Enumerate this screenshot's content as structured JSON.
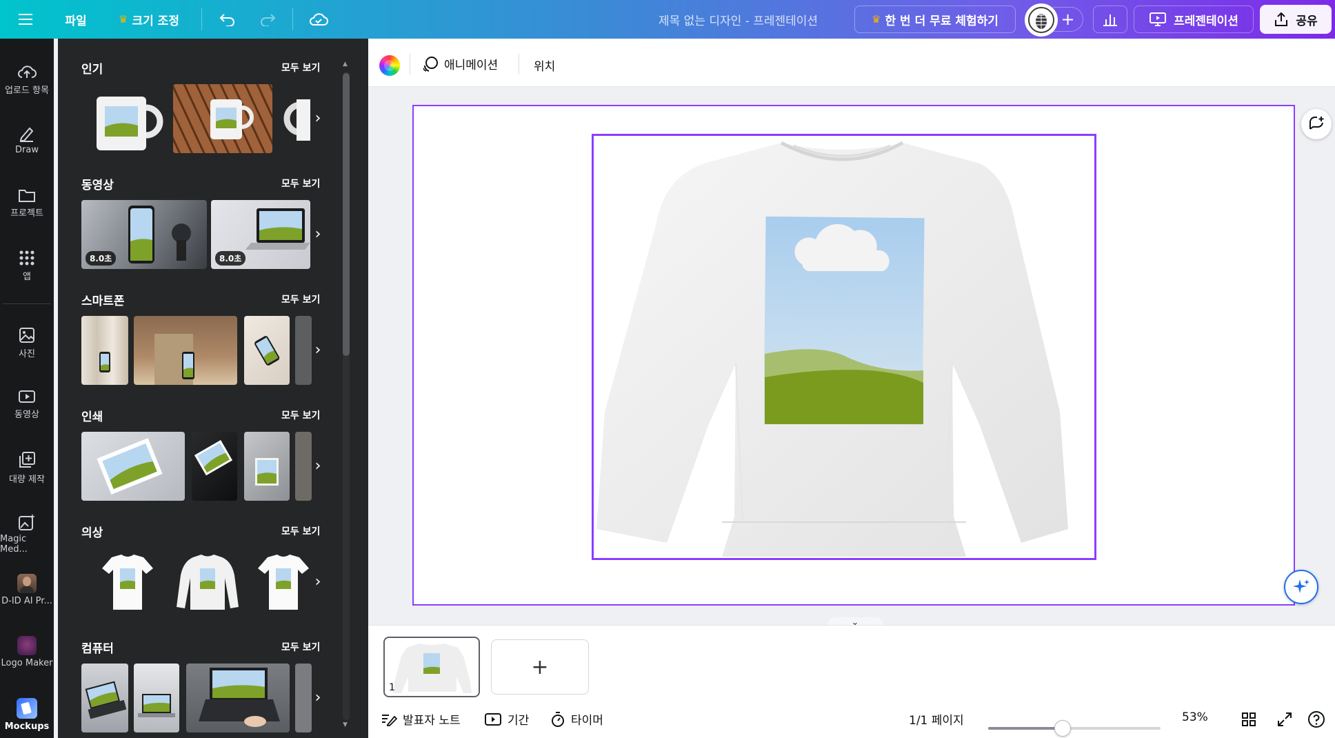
{
  "topbar": {
    "menu_icon": "hamburger-icon",
    "file_label": "파일",
    "resize_label": "크기 조정",
    "doc_title": "제목 없는 디자인 - 프레젠테이션",
    "trial_label": "한 번 더 무료 체험하기",
    "present_label": "프레젠테이션",
    "share_label": "공유",
    "accent": "#7d2ae8"
  },
  "rail": {
    "items": [
      {
        "label": "업로드 항목",
        "icon": "cloud-upload-icon"
      },
      {
        "label": "Draw",
        "icon": "draw-icon"
      },
      {
        "label": "프로젝트",
        "icon": "folder-icon"
      },
      {
        "label": "앱",
        "icon": "apps-grid-icon"
      },
      {
        "label": "사진",
        "icon": "photo-icon"
      },
      {
        "label": "동영상",
        "icon": "video-icon"
      },
      {
        "label": "대량 제작",
        "icon": "bulk-create-icon"
      },
      {
        "label": "Magic Med...",
        "icon": "magic-media-icon"
      },
      {
        "label": "D-ID AI Pr...",
        "icon": "did-avatar-icon"
      },
      {
        "label": "Logo Maker",
        "icon": "logo-maker-icon"
      },
      {
        "label": "Mockups",
        "icon": "mockups-icon"
      }
    ]
  },
  "panel": {
    "see_all": "모두 보기",
    "sections": [
      {
        "title": "인기"
      },
      {
        "title": "동영상",
        "durations": [
          "8.0초",
          "8.0초"
        ]
      },
      {
        "title": "스마트폰"
      },
      {
        "title": "인쇄"
      },
      {
        "title": "의상"
      },
      {
        "title": "컴퓨터"
      }
    ]
  },
  "context": {
    "animation_label": "애니메이션",
    "position_label": "위치"
  },
  "pages": {
    "first_page_number": "1",
    "add_label": "+"
  },
  "footer": {
    "notes_label": "발표자 노트",
    "duration_label": "기간",
    "timer_label": "타이머",
    "page_indicator": "1/1 페이지",
    "zoom_label": "53%",
    "zoom_fraction": 0.43
  }
}
